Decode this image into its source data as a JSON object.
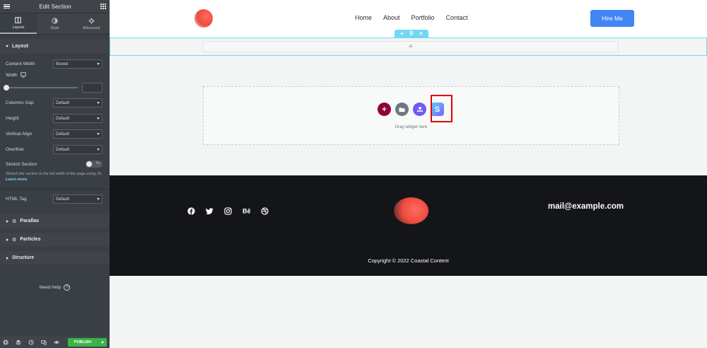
{
  "sidebar": {
    "header_title": "Edit Section",
    "tabs": [
      {
        "label": "Layout",
        "icon": "layout-icon"
      },
      {
        "label": "Style",
        "icon": "style-icon"
      },
      {
        "label": "Advanced",
        "icon": "gear-icon"
      }
    ],
    "layout_section": "Layout",
    "controls": {
      "content_width_label": "Content Width",
      "content_width_value": "Boxed",
      "width_label": "Width",
      "columns_gap_label": "Columns Gap",
      "columns_gap_value": "Default",
      "height_label": "Height",
      "height_value": "Default",
      "vertical_align_label": "Vertical Align",
      "vertical_align_value": "Default",
      "overflow_label": "Overflow",
      "overflow_value": "Default",
      "stretch_label": "Stretch Section",
      "stretch_toggle": "No",
      "stretch_desc": "Stretch the section to the full width of the page using JS.",
      "learn_more": "Learn more.",
      "html_tag_label": "HTML Tag",
      "html_tag_value": "Default"
    },
    "accordions": [
      {
        "label": "Parallax"
      },
      {
        "label": "Particles"
      },
      {
        "label": "Structure"
      }
    ],
    "need_help": "Need Help",
    "publish_label": "PUBLISH"
  },
  "site": {
    "nav": [
      "Home",
      "About",
      "Portfolio",
      "Contact"
    ],
    "hire_button": "Hire Me",
    "dropzone_text": "Drag widget here",
    "footer_email": "mail@example.com",
    "copyright": "Copyright © 2022 Coastal Content"
  },
  "colors": {
    "accent_blue": "#4285f4",
    "editor_cyan": "#71d7f7",
    "publish_green": "#39b54a",
    "highlight_red": "#e00000"
  }
}
